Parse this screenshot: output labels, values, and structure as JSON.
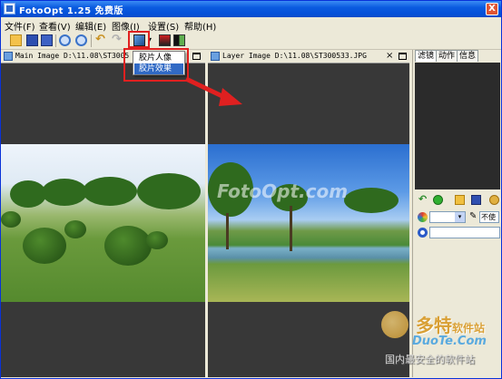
{
  "window": {
    "title": "FotoOpt 1.25 免费版",
    "close_glyph": "X"
  },
  "menubar": {
    "items": [
      "文件(F)",
      "查看(V)",
      "编辑(E)",
      "图像(I)",
      "设置(S)",
      "帮助(H)"
    ]
  },
  "toolbar": {
    "icons": [
      "open-icon",
      "save-icon",
      "save-as-icon",
      "zoom-in-icon",
      "zoom-out-icon",
      "undo-icon",
      "redo-icon",
      "film-effect-icon",
      "portrait-icon",
      "black-white-icon"
    ],
    "undo_glyph": "↶",
    "redo_glyph": "↷",
    "dropdown_glyph": "▾"
  },
  "film_menu": {
    "items": [
      "胶片人像",
      "胶片效果"
    ],
    "selected": "胶片效果"
  },
  "left_panel": {
    "caption": "Main Image D:\\11.08\\ST3005",
    "close_glyph": "×"
  },
  "right_panel": {
    "caption": "Layer Image D:\\11.08\\ST300533.JPG",
    "close_glyph": "×",
    "watermark": "FotoOpt.com"
  },
  "dock": {
    "tabs": [
      "滤镜",
      "动作",
      "信息"
    ],
    "active_tab": "滤镜",
    "tools": [
      "back-icon",
      "play-icon",
      "open-icon",
      "save-icon",
      "gear-icon"
    ],
    "back_glyph": "↶",
    "select_arrow": "▾",
    "pen_glyph": "✎",
    "opacity_label": "不使"
  },
  "branding": {
    "name_cn": "多特",
    "name_cn_suffix": "软件站",
    "name_en": "DuoTe.Com",
    "tagline": "国内最安全的软件站"
  },
  "colors": {
    "titlebar": "#0a5be0",
    "highlight": "#316ac5",
    "callout": "#e02020"
  }
}
